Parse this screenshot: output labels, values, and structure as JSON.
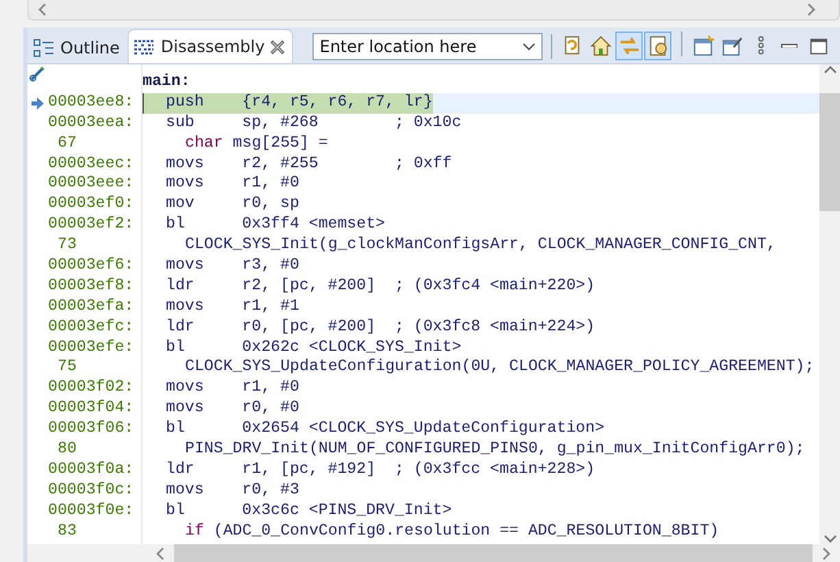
{
  "tabs": [
    {
      "label": "Outline",
      "selected": false,
      "closable": false,
      "kind": "outline"
    },
    {
      "label": "Disassembly",
      "selected": true,
      "closable": true,
      "kind": "disassembly"
    }
  ],
  "location": {
    "value": "Enter location here"
  },
  "toolbar": [
    {
      "kind": "refresh",
      "selected": false
    },
    {
      "kind": "home",
      "selected": false
    },
    {
      "kind": "link",
      "selected": true
    },
    {
      "kind": "source",
      "selected": true
    },
    {
      "kind": "new-view",
      "selected": false
    },
    {
      "kind": "pin",
      "selected": false
    },
    {
      "kind": "more",
      "selected": false
    },
    {
      "kind": "minimize",
      "selected": false
    },
    {
      "kind": "maximize",
      "selected": false
    }
  ],
  "rows": [
    {
      "kind": "label",
      "text": "main:"
    },
    {
      "kind": "instruction",
      "address": "00003ee8:",
      "mnemonic": "push",
      "operands": "{r4, r5, r6, r7, lr}",
      "current": true
    },
    {
      "kind": "instruction",
      "address": "00003eea:",
      "mnemonic": "sub",
      "operands": "sp, #268",
      "comment": "; 0x10c",
      "current": false
    },
    {
      "kind": "source",
      "line": "67",
      "keyword": "char",
      "text": " msg[255] ="
    },
    {
      "kind": "instruction",
      "address": "00003eec:",
      "mnemonic": "movs",
      "operands": "r2, #255",
      "comment": "; 0xff",
      "current": false
    },
    {
      "kind": "instruction",
      "address": "00003eee:",
      "mnemonic": "movs",
      "operands": "r1, #0",
      "current": false
    },
    {
      "kind": "instruction",
      "address": "00003ef0:",
      "mnemonic": "mov",
      "operands": "r0, sp",
      "current": false
    },
    {
      "kind": "instruction",
      "address": "00003ef2:",
      "mnemonic": "bl",
      "operands": "0x3ff4 <memset>",
      "current": false
    },
    {
      "kind": "source",
      "line": "73",
      "text": "CLOCK_SYS_Init(g_clockManConfigsArr, CLOCK_MANAGER_CONFIG_CNT,"
    },
    {
      "kind": "instruction",
      "address": "00003ef6:",
      "mnemonic": "movs",
      "operands": "r3, #0",
      "current": false
    },
    {
      "kind": "instruction",
      "address": "00003ef8:",
      "mnemonic": "ldr",
      "operands": "r2, [pc, #200]",
      "comment": "; (0x3fc4 <main+220>)",
      "current": false
    },
    {
      "kind": "instruction",
      "address": "00003efa:",
      "mnemonic": "movs",
      "operands": "r1, #1",
      "current": false
    },
    {
      "kind": "instruction",
      "address": "00003efc:",
      "mnemonic": "ldr",
      "operands": "r0, [pc, #200]",
      "comment": "; (0x3fc8 <main+224>)",
      "current": false
    },
    {
      "kind": "instruction",
      "address": "00003efe:",
      "mnemonic": "bl",
      "operands": "0x262c <CLOCK_SYS_Init>",
      "current": false
    },
    {
      "kind": "source",
      "line": "75",
      "text": "CLOCK_SYS_UpdateConfiguration(0U, CLOCK_MANAGER_POLICY_AGREEMENT);"
    },
    {
      "kind": "instruction",
      "address": "00003f02:",
      "mnemonic": "movs",
      "operands": "r1, #0",
      "current": false
    },
    {
      "kind": "instruction",
      "address": "00003f04:",
      "mnemonic": "movs",
      "operands": "r0, #0",
      "current": false
    },
    {
      "kind": "instruction",
      "address": "00003f06:",
      "mnemonic": "bl",
      "operands": "0x2654 <CLOCK_SYS_UpdateConfiguration>",
      "current": false
    },
    {
      "kind": "source",
      "line": "80",
      "text": "PINS_DRV_Init(NUM_OF_CONFIGURED_PINS0, g_pin_mux_InitConfigArr0);"
    },
    {
      "kind": "instruction",
      "address": "00003f0a:",
      "mnemonic": "ldr",
      "operands": "r1, [pc, #192]",
      "comment": "; (0x3fcc <main+228>)",
      "current": false
    },
    {
      "kind": "instruction",
      "address": "00003f0c:",
      "mnemonic": "movs",
      "operands": "r0, #3",
      "current": false
    },
    {
      "kind": "instruction",
      "address": "00003f0e:",
      "mnemonic": "bl",
      "operands": "0x3c6c <PINS_DRV_Init>",
      "current": false
    },
    {
      "kind": "source",
      "line": "83",
      "keyword": "if",
      "text": " (ADC_0_ConvConfig0.resolution == ADC_RESOLUTION_8BIT)"
    }
  ]
}
